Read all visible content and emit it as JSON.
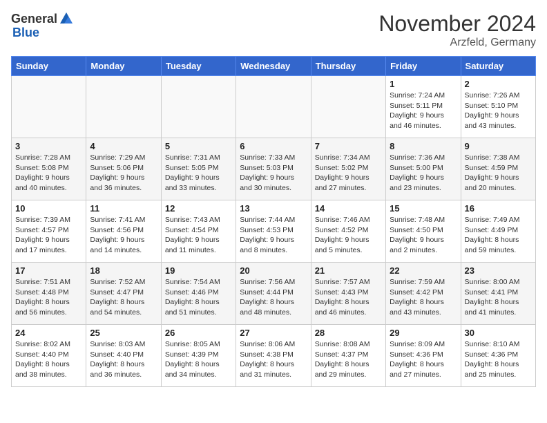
{
  "logo": {
    "general": "General",
    "blue": "Blue"
  },
  "title": "November 2024",
  "location": "Arzfeld, Germany",
  "days_of_week": [
    "Sunday",
    "Monday",
    "Tuesday",
    "Wednesday",
    "Thursday",
    "Friday",
    "Saturday"
  ],
  "weeks": [
    [
      {
        "day": "",
        "info": ""
      },
      {
        "day": "",
        "info": ""
      },
      {
        "day": "",
        "info": ""
      },
      {
        "day": "",
        "info": ""
      },
      {
        "day": "",
        "info": ""
      },
      {
        "day": "1",
        "info": "Sunrise: 7:24 AM\nSunset: 5:11 PM\nDaylight: 9 hours and 46 minutes."
      },
      {
        "day": "2",
        "info": "Sunrise: 7:26 AM\nSunset: 5:10 PM\nDaylight: 9 hours and 43 minutes."
      }
    ],
    [
      {
        "day": "3",
        "info": "Sunrise: 7:28 AM\nSunset: 5:08 PM\nDaylight: 9 hours and 40 minutes."
      },
      {
        "day": "4",
        "info": "Sunrise: 7:29 AM\nSunset: 5:06 PM\nDaylight: 9 hours and 36 minutes."
      },
      {
        "day": "5",
        "info": "Sunrise: 7:31 AM\nSunset: 5:05 PM\nDaylight: 9 hours and 33 minutes."
      },
      {
        "day": "6",
        "info": "Sunrise: 7:33 AM\nSunset: 5:03 PM\nDaylight: 9 hours and 30 minutes."
      },
      {
        "day": "7",
        "info": "Sunrise: 7:34 AM\nSunset: 5:02 PM\nDaylight: 9 hours and 27 minutes."
      },
      {
        "day": "8",
        "info": "Sunrise: 7:36 AM\nSunset: 5:00 PM\nDaylight: 9 hours and 23 minutes."
      },
      {
        "day": "9",
        "info": "Sunrise: 7:38 AM\nSunset: 4:59 PM\nDaylight: 9 hours and 20 minutes."
      }
    ],
    [
      {
        "day": "10",
        "info": "Sunrise: 7:39 AM\nSunset: 4:57 PM\nDaylight: 9 hours and 17 minutes."
      },
      {
        "day": "11",
        "info": "Sunrise: 7:41 AM\nSunset: 4:56 PM\nDaylight: 9 hours and 14 minutes."
      },
      {
        "day": "12",
        "info": "Sunrise: 7:43 AM\nSunset: 4:54 PM\nDaylight: 9 hours and 11 minutes."
      },
      {
        "day": "13",
        "info": "Sunrise: 7:44 AM\nSunset: 4:53 PM\nDaylight: 9 hours and 8 minutes."
      },
      {
        "day": "14",
        "info": "Sunrise: 7:46 AM\nSunset: 4:52 PM\nDaylight: 9 hours and 5 minutes."
      },
      {
        "day": "15",
        "info": "Sunrise: 7:48 AM\nSunset: 4:50 PM\nDaylight: 9 hours and 2 minutes."
      },
      {
        "day": "16",
        "info": "Sunrise: 7:49 AM\nSunset: 4:49 PM\nDaylight: 8 hours and 59 minutes."
      }
    ],
    [
      {
        "day": "17",
        "info": "Sunrise: 7:51 AM\nSunset: 4:48 PM\nDaylight: 8 hours and 56 minutes."
      },
      {
        "day": "18",
        "info": "Sunrise: 7:52 AM\nSunset: 4:47 PM\nDaylight: 8 hours and 54 minutes."
      },
      {
        "day": "19",
        "info": "Sunrise: 7:54 AM\nSunset: 4:46 PM\nDaylight: 8 hours and 51 minutes."
      },
      {
        "day": "20",
        "info": "Sunrise: 7:56 AM\nSunset: 4:44 PM\nDaylight: 8 hours and 48 minutes."
      },
      {
        "day": "21",
        "info": "Sunrise: 7:57 AM\nSunset: 4:43 PM\nDaylight: 8 hours and 46 minutes."
      },
      {
        "day": "22",
        "info": "Sunrise: 7:59 AM\nSunset: 4:42 PM\nDaylight: 8 hours and 43 minutes."
      },
      {
        "day": "23",
        "info": "Sunrise: 8:00 AM\nSunset: 4:41 PM\nDaylight: 8 hours and 41 minutes."
      }
    ],
    [
      {
        "day": "24",
        "info": "Sunrise: 8:02 AM\nSunset: 4:40 PM\nDaylight: 8 hours and 38 minutes."
      },
      {
        "day": "25",
        "info": "Sunrise: 8:03 AM\nSunset: 4:40 PM\nDaylight: 8 hours and 36 minutes."
      },
      {
        "day": "26",
        "info": "Sunrise: 8:05 AM\nSunset: 4:39 PM\nDaylight: 8 hours and 34 minutes."
      },
      {
        "day": "27",
        "info": "Sunrise: 8:06 AM\nSunset: 4:38 PM\nDaylight: 8 hours and 31 minutes."
      },
      {
        "day": "28",
        "info": "Sunrise: 8:08 AM\nSunset: 4:37 PM\nDaylight: 8 hours and 29 minutes."
      },
      {
        "day": "29",
        "info": "Sunrise: 8:09 AM\nSunset: 4:36 PM\nDaylight: 8 hours and 27 minutes."
      },
      {
        "day": "30",
        "info": "Sunrise: 8:10 AM\nSunset: 4:36 PM\nDaylight: 8 hours and 25 minutes."
      }
    ]
  ]
}
